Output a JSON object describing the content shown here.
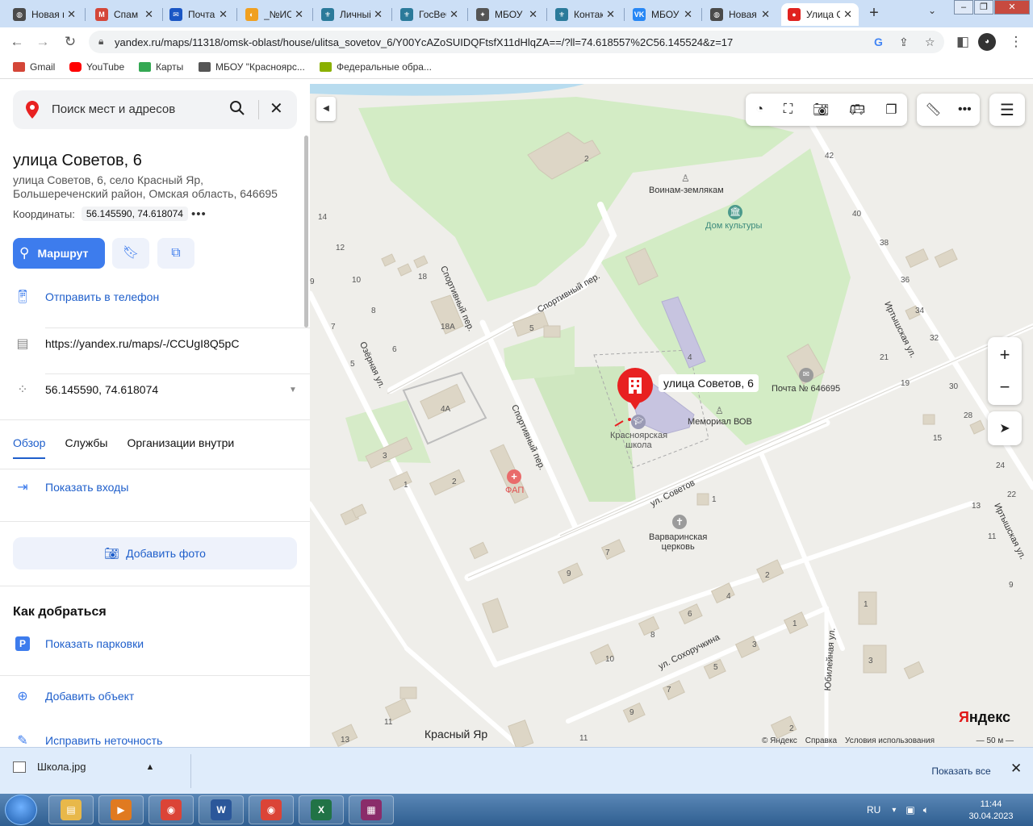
{
  "browser": {
    "tabs": [
      {
        "label": "Новая вкладка",
        "color": "#4a4a4a",
        "glyph": "◍"
      },
      {
        "label": "Спам",
        "color": "#d44638",
        "glyph": "M"
      },
      {
        "label": "Почта",
        "color": "#1a56c4",
        "glyph": "✉"
      },
      {
        "label": "_№ИС",
        "color": "#f0a020",
        "glyph": "◐"
      },
      {
        "label": "Личный кабинет",
        "color": "#2b7a9a",
        "glyph": "⚜"
      },
      {
        "label": "ГосВеб",
        "color": "#2b7a9a",
        "glyph": "⚜"
      },
      {
        "label": "МБОУ",
        "color": "#555555",
        "glyph": "✦"
      },
      {
        "label": "Контакты",
        "color": "#2b7a9a",
        "glyph": "⚜"
      },
      {
        "label": "МБОУ",
        "color": "#2787f5",
        "glyph": "VK"
      },
      {
        "label": "Новая вкладка",
        "color": "#4a4a4a",
        "glyph": "◍"
      },
      {
        "label": "Улица Советов",
        "color": "#e0221f",
        "glyph": "●"
      }
    ],
    "new_tab": "+",
    "tab_menu": "⌄",
    "window_buttons": [
      "–",
      "❐",
      "✕"
    ],
    "url": "yandex.ru/maps/11318/omsk-oblast/house/ulitsa_sovetov_6/Y00YcAZoSUIDQFtsfX11dHlqZA==/?ll=74.618557%2C56.145524&z=17",
    "bookmarks": [
      {
        "label": "Gmail",
        "color": "#d44638"
      },
      {
        "label": "YouTube",
        "color": "#ff0000"
      },
      {
        "label": "Карты",
        "color": "#34a853"
      },
      {
        "label": "МБОУ \"Красноярс...",
        "color": "#555555"
      },
      {
        "label": "Федеральные обра...",
        "color": "#8ab000"
      }
    ]
  },
  "sidebar": {
    "search_placeholder": "Поиск мест и адресов",
    "title": "улица Советов, 6",
    "address_line1": "улица Советов, 6, село Красный Яр,",
    "address_line2": "Большереченский район, Омская область, 646695",
    "coords_label": "Координаты:",
    "coords_value": "56.145590, 74.618074",
    "route_label": "Маршрут",
    "send_phone": "Отправить в телефон",
    "share_url": "https://yandex.ru/maps/-/CCUgI8Q5pC",
    "coords_row": "56.145590, 74.618074",
    "tabs": [
      "Обзор",
      "Службы",
      "Организации внутри"
    ],
    "show_entrances": "Показать входы",
    "add_photo": "Добавить фото",
    "howto_title": "Как добраться",
    "show_parking": "Показать парковки",
    "add_object": "Добавить объект",
    "fix_info": "Исправить неточность"
  },
  "map": {
    "pin_label": "улица Советов, 6",
    "poi": {
      "warriors": "Воинам-землякам",
      "culture": "Дом культуры",
      "post": "Почта № 646695",
      "memorial": "Мемориал ВОВ",
      "school_1": "Красноярская",
      "school_2": "школа",
      "fap": "ФАП",
      "church_1": "Варваринская",
      "church_2": "церковь",
      "village": "Красный Яр"
    },
    "streets": {
      "sport_1": "Спортивный пер.",
      "sport_2": "Спортивный пер.",
      "sport_3": "Спортивный пер.",
      "ozer": "Озёрная ул.",
      "irtysh_1": "Иртышская ул.",
      "irtysh_2": "Иртышская ул.",
      "sovetov": "ул. Советов",
      "sokhor": "ул. Сохоручкина",
      "yubil": "Юбилейная ул."
    },
    "numbers": {
      "n2a": "2",
      "n42": "42",
      "n40": "40",
      "n38": "38",
      "n36": "36",
      "n34": "34",
      "n32": "32",
      "n21": "21",
      "n19": "19",
      "n30": "30",
      "n28": "28",
      "n15": "15",
      "n24": "24",
      "n22": "22",
      "n13r": "13",
      "n11r": "11",
      "n9r": "9",
      "n14": "14",
      "n12": "12",
      "n10": "10",
      "n18": "18",
      "n8": "8",
      "n7": "7",
      "n6": "6",
      "n5l": "5",
      "n18a": "18А",
      "n5": "5",
      "n4": "4",
      "n4a": "4А",
      "n3": "3",
      "n1": "1",
      "n2": "2",
      "n1b": "1",
      "n7b": "7",
      "n9b": "9",
      "n2c": "2",
      "n4c": "4",
      "n6c": "6",
      "n8c": "8",
      "n1c": "1",
      "n3c": "3",
      "n10c": "10",
      "n5c": "5",
      "n7c": "7",
      "n9c": "9",
      "n2d": "2",
      "n1d": "1",
      "n3d": "3",
      "n11b": "11",
      "n13b": "13",
      "n11c": "11",
      "n9e": "9"
    },
    "logo_y": "Я",
    "logo_rest": "ндекс",
    "footer": [
      "© Яндекс",
      "Справка",
      "Условия использования"
    ],
    "scale": "50 м"
  },
  "downloads": {
    "file": "Школа.jpg",
    "show_all": "Показать все"
  },
  "taskbar": {
    "lang": "RU",
    "time": "11:44",
    "date": "30.04.2023",
    "apps": [
      {
        "name": "explorer",
        "color": "#e8b84a",
        "glyph": "▤"
      },
      {
        "name": "media",
        "color": "#e07a20",
        "glyph": "▶"
      },
      {
        "name": "chrome",
        "color": "#db4437",
        "glyph": "◉"
      },
      {
        "name": "word",
        "color": "#2b579a",
        "glyph": "W"
      },
      {
        "name": "chrome",
        "color": "#db4437",
        "glyph": "◉"
      },
      {
        "name": "excel",
        "color": "#217346",
        "glyph": "X"
      },
      {
        "name": "winrar",
        "color": "#8a2c6a",
        "glyph": "▦"
      }
    ]
  },
  "colors": {
    "accent": "#3d7ced",
    "park": "#d3ecc5",
    "building": "#ddd6c6",
    "school": "#c7c4e0",
    "pin": "#e82121"
  }
}
